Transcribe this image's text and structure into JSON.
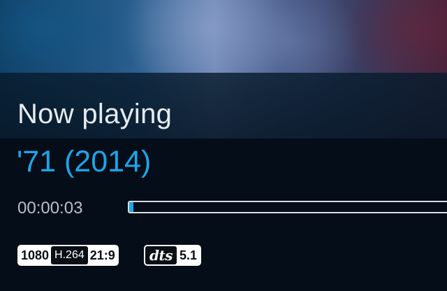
{
  "player": {
    "heading": "Now playing",
    "title": "'71 (2014)",
    "elapsed": "00:00:03",
    "progress_fraction": 0.01
  },
  "badges": {
    "video": {
      "resolution": "1080",
      "codec": "H.264",
      "aspect": "21:9"
    },
    "audio": {
      "logo": "dts",
      "channels": "5.1"
    }
  },
  "colors": {
    "accent": "#1ba7ea",
    "background": "#050d18",
    "heading_text": "#e6ebf0"
  }
}
